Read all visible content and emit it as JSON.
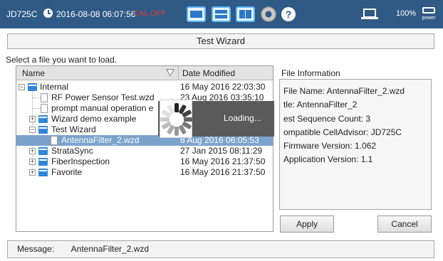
{
  "status_bar": {
    "model": "JD725C",
    "datetime": "2016-08-08 06:07:56",
    "cal_status": "CAL OFF",
    "battery": "100%",
    "power_label": "power",
    "icons": [
      "clock-icon",
      "layout-single-icon",
      "layout-split-horizontal-icon",
      "layout-split-vertical-icon",
      "gear-icon",
      "help-icon",
      "laptop-icon",
      "power-icon"
    ],
    "colors": {
      "bar": "#2f5a86",
      "cal_off": "#e03c3c"
    }
  },
  "dialog": {
    "title": "Test Wizard",
    "prompt": "Select a file you want to load.",
    "columns": {
      "name": "Name",
      "date": "Date Modified"
    },
    "rows": [
      {
        "name": "Internal",
        "date": "16 May 2016 22:03:30",
        "kind": "folder",
        "level": 0
      },
      {
        "name": "RF Power Sensor Test.wzd",
        "date": "23 Aug 2016 03:35:10",
        "kind": "file",
        "level": 1
      },
      {
        "name": "prompt manual operation e",
        "date": "",
        "kind": "file",
        "level": 1
      },
      {
        "name": "Wizard demo example",
        "date": "",
        "kind": "folder",
        "level": 1
      },
      {
        "name": "Test Wizard",
        "date": "",
        "kind": "folder",
        "level": 1
      },
      {
        "name": "AntennaFilter_2.wzd",
        "date": "8 Aug 2016 06:05:53",
        "kind": "file",
        "level": 2,
        "selected": true
      },
      {
        "name": "StrataSync",
        "date": "27 Jan 2015 08:11:29",
        "kind": "folder",
        "level": 1
      },
      {
        "name": "FiberInspection",
        "date": "16 May 2016 21:37:50",
        "kind": "folder",
        "level": 1
      },
      {
        "name": "Favorite",
        "date": "16 May 2016 21:37:50",
        "kind": "folder",
        "level": 1
      }
    ],
    "loading_text": "Loading...",
    "info": {
      "title": "File Information",
      "lines": [
        "File Name: AntennaFilter_2.wzd",
        "tle: AntennaFilter_2",
        "est Sequence Count: 3",
        "ompatible CellAdvisor: JD725C",
        "Firmware Version: 1.062",
        "Application Version: 1.1"
      ]
    },
    "buttons": {
      "apply": "Apply",
      "cancel": "Cancel"
    },
    "message": {
      "label": "Message:",
      "value": "AntennaFilter_2.wzd"
    }
  }
}
